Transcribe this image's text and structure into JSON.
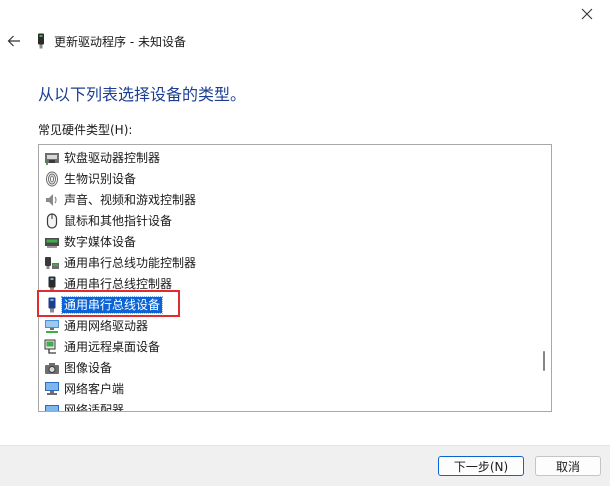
{
  "window": {
    "title": "更新驱动程序 - 未知设备"
  },
  "heading": "从以下列表选择设备的类型。",
  "list": {
    "label": "常见硬件类型(H):",
    "items": [
      {
        "label": "软盘驱动器控制器",
        "icon": "floppy-controller-icon"
      },
      {
        "label": "生物识别设备",
        "icon": "fingerprint-icon"
      },
      {
        "label": "声音、视频和游戏控制器",
        "icon": "speaker-icon"
      },
      {
        "label": "鼠标和其他指针设备",
        "icon": "mouse-icon"
      },
      {
        "label": "数字媒体设备",
        "icon": "media-device-icon"
      },
      {
        "label": "通用串行总线功能控制器",
        "icon": "usb-function-controller-icon"
      },
      {
        "label": "通用串行总线控制器",
        "icon": "usb-controller-icon"
      },
      {
        "label": "通用串行总线设备",
        "icon": "usb-device-icon"
      },
      {
        "label": "通用网络驱动器",
        "icon": "network-drive-icon"
      },
      {
        "label": "通用远程桌面设备",
        "icon": "remote-desktop-icon"
      },
      {
        "label": "图像设备",
        "icon": "camera-icon"
      },
      {
        "label": "网络客户端",
        "icon": "network-client-icon"
      },
      {
        "label": "网络适配器",
        "icon": "network-adapter-icon"
      }
    ],
    "selected_index": 7
  },
  "buttons": {
    "next": "下一步(N)",
    "cancel": "取消"
  },
  "colors": {
    "heading": "#1c3f94",
    "selection": "#0a64d6",
    "highlight_box": "#e02b30",
    "footer": "#f0f0f0"
  }
}
